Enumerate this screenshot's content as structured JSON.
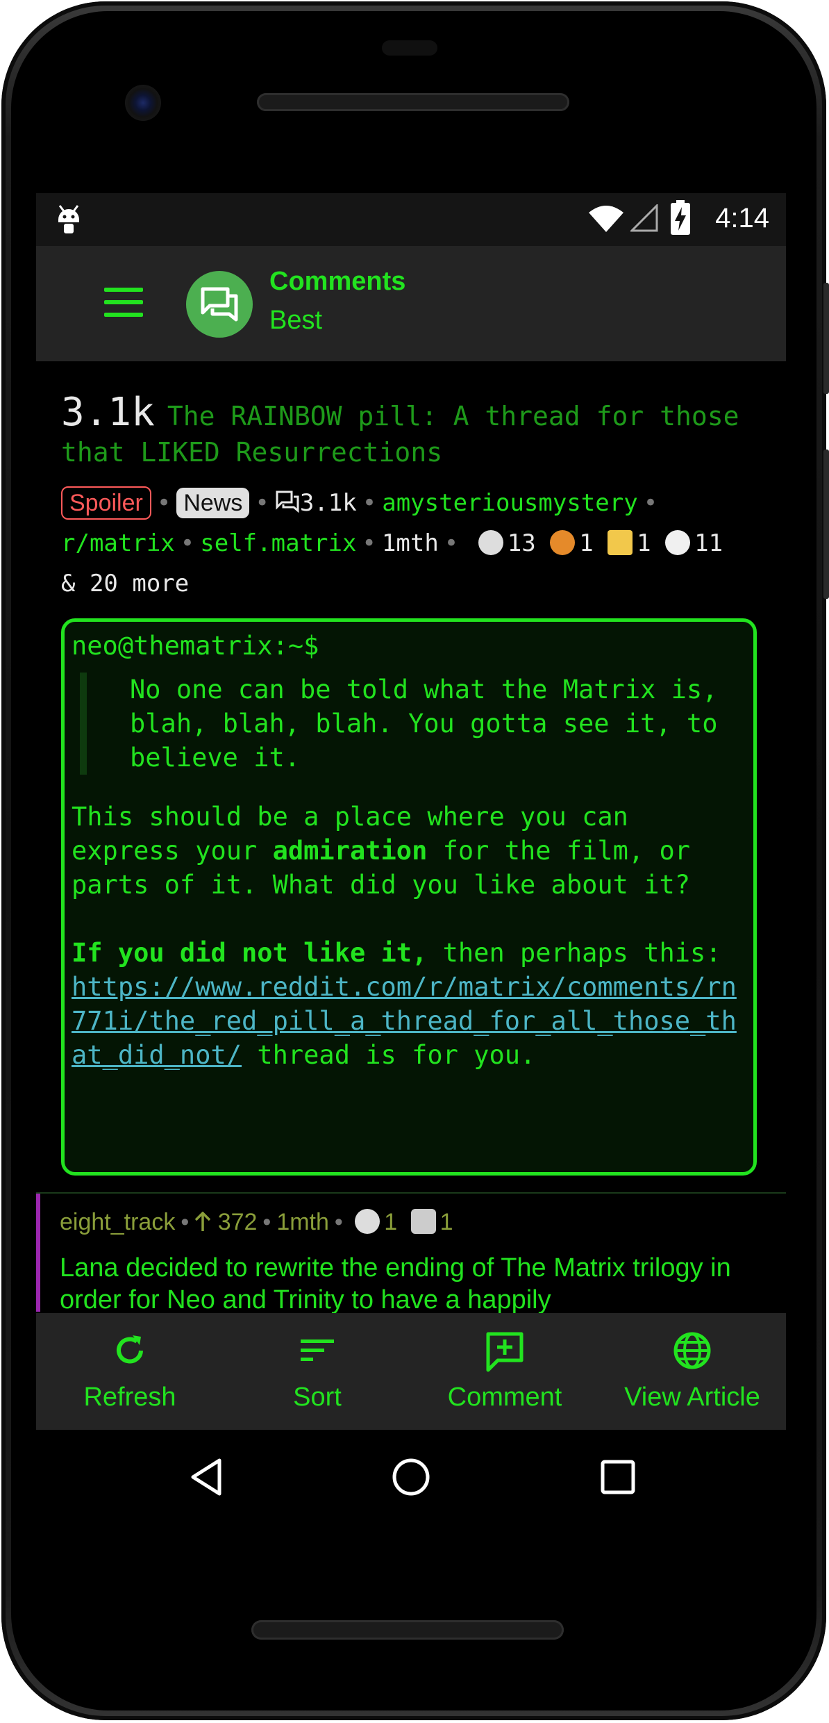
{
  "status_bar": {
    "time": "4:14"
  },
  "toolbar": {
    "title": "Comments",
    "subtitle": "Best"
  },
  "post": {
    "score": "3.1k",
    "title": "The RAINBOW pill: A thread for those that LIKED Resurrections",
    "tags": [
      "Spoiler",
      "News"
    ],
    "comment_count": "3.1k",
    "author": "amysteriousmystery",
    "subreddit": "r/matrix",
    "domain": "self.matrix",
    "age": "1mth",
    "awards": [
      "13",
      "1",
      "1",
      "11"
    ],
    "awards_more": "& 20 more"
  },
  "body": {
    "prompt": "neo@thematrix:~$",
    "quote": "No one can be told what the Matrix is, blah, blah, blah. You gotta see it, to believe it.",
    "para1_a": "This should be a place where you can express your ",
    "para1_bold": "admiration",
    "para1_b": " for the film, or parts of it. What did you like about it?",
    "para2_bold": "If you did not like it,",
    "para2_a": " then perhaps this: ",
    "link": "https://www.reddit.com/r/matrix/comments/rn771i/the_red_pill_a_thread_for_all_those_that_did_not/",
    "para2_b": " thread is for you."
  },
  "comment": {
    "author": "eight_track",
    "score": "372",
    "age": "1mth",
    "awards": [
      "1",
      "1"
    ],
    "text": "Lana decided to rewrite the ending of The Matrix trilogy in order for Neo and Trinity to have a happily"
  },
  "bottom_bar": [
    {
      "label": "Refresh",
      "icon": "refresh-icon"
    },
    {
      "label": "Sort",
      "icon": "sort-icon"
    },
    {
      "label": "Comment",
      "icon": "add-comment-icon"
    },
    {
      "label": "View Article",
      "icon": "globe-icon"
    }
  ],
  "colors": {
    "accent": "#22e31f",
    "link": "#4db6c6",
    "spoiler": "#ff5a5a"
  }
}
